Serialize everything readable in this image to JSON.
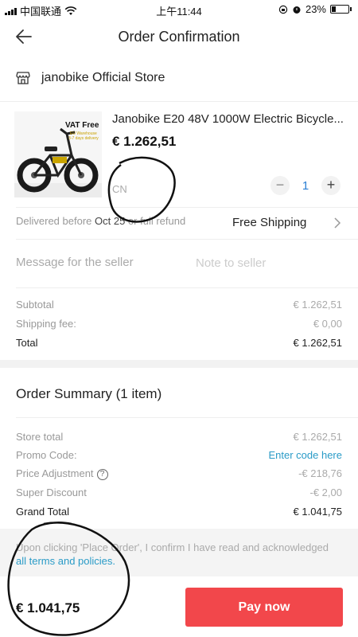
{
  "status_bar": {
    "carrier": "中国联通",
    "time": "上午11:44",
    "battery": "23%"
  },
  "nav": {
    "title": "Order Confirmation",
    "back_icon": "back-arrow-icon"
  },
  "store": {
    "icon": "store-icon",
    "name": "janobike Official Store"
  },
  "product": {
    "image_badge": "VAT Free",
    "image_sub": "EU Warehouse\n3-7 days delivery",
    "title": "Janobike E20 48V 1000W Electric Bicycle...",
    "price": "€ 1.262,51",
    "ship_from": "CN",
    "quantity": "1",
    "minus_label": "−",
    "plus_label": "+"
  },
  "delivery": {
    "prefix": "Delivered before",
    "date": "Oct 25",
    "suffix": "or full refund",
    "shipping": "Free Shipping"
  },
  "message": {
    "label": "Message for the seller",
    "placeholder": "Note to seller"
  },
  "costs": {
    "subtotal_label": "Subtotal",
    "subtotal_value": "€ 1.262,51",
    "shipping_label": "Shipping fee:",
    "shipping_value": "€ 0,00",
    "total_label": "Total",
    "total_value": "€ 1.262,51"
  },
  "summary": {
    "title": "Order Summary (1 item)",
    "store_total_label": "Store total",
    "store_total_value": "€ 1.262,51",
    "promo_label": "Promo Code:",
    "promo_link": "Enter code here",
    "price_adj_label": "Price Adjustment",
    "price_adj_value": "-€ 218,76",
    "super_discount_label": "Super Discount",
    "super_discount_value": "-€ 2,00",
    "grand_total_label": "Grand Total",
    "grand_total_value": "€ 1.041,75"
  },
  "notice": {
    "text": "Upon clicking 'Place Order', I confirm I have read and acknowledged",
    "link": "all terms and policies."
  },
  "footer": {
    "total": "€ 1.041,75",
    "pay_button": "Pay now"
  },
  "colors": {
    "accent_red": "#f2474b",
    "link_blue": "#2a9bc7",
    "qty_blue": "#2a7fd4"
  }
}
